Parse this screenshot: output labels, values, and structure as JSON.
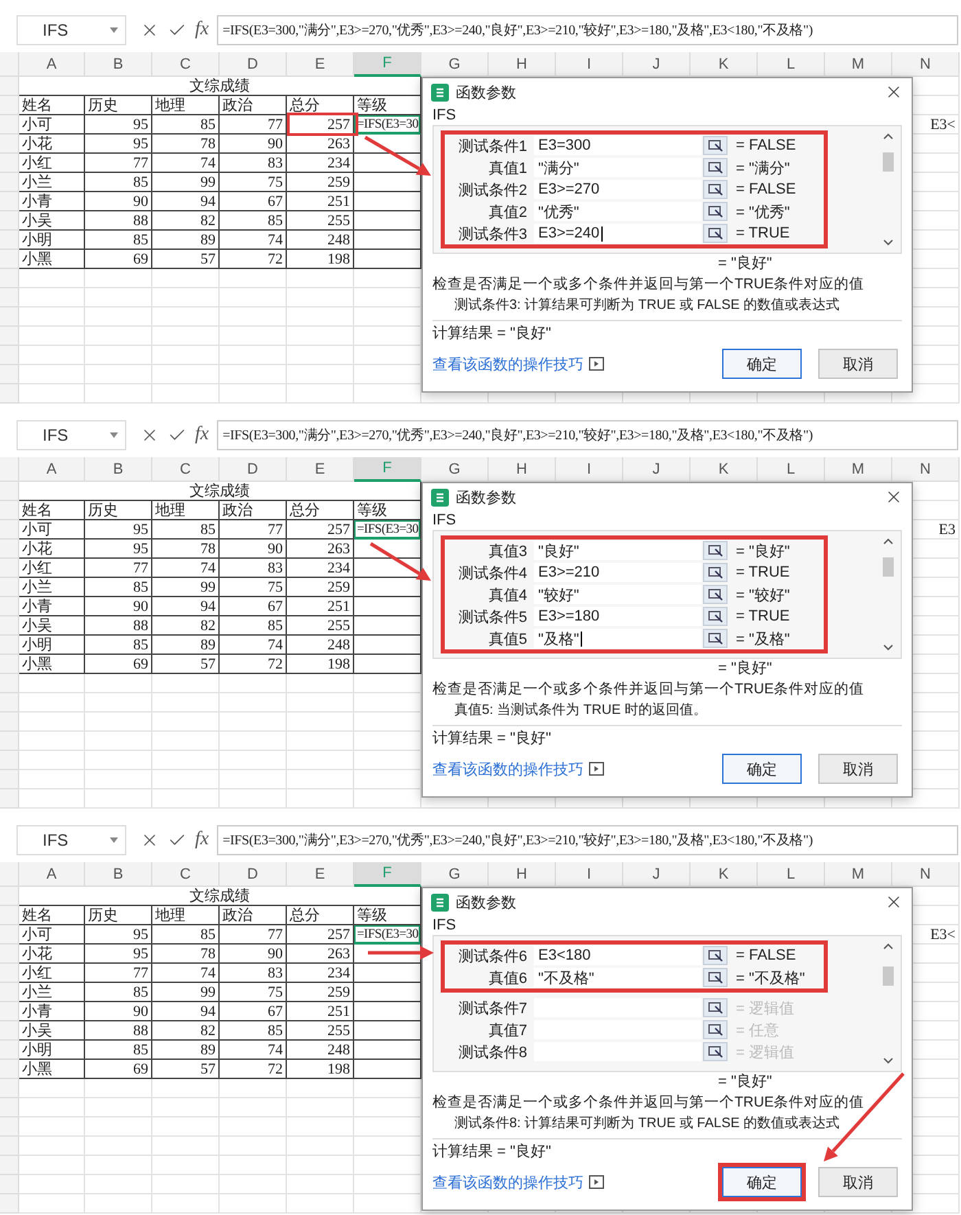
{
  "panels": [
    {
      "name_box": "IFS",
      "fx_label": "fx",
      "formula": "=IFS(E3=300,\"满分\",E3>=270,\"优秀\",E3>=240,\"良好\",E3>=210,\"较好\",E3>=180,\"及格\",E3<180,\"不及格\")",
      "columns": [
        {
          "label": "A",
          "selected": false
        },
        {
          "label": "B",
          "selected": false
        },
        {
          "label": "C",
          "selected": false
        },
        {
          "label": "D",
          "selected": false
        },
        {
          "label": "E",
          "selected": false
        },
        {
          "label": "F",
          "selected": true
        },
        {
          "label": "G",
          "selected": false
        },
        {
          "label": "H",
          "selected": false
        },
        {
          "label": "I",
          "selected": false
        },
        {
          "label": "J",
          "selected": false
        },
        {
          "label": "K",
          "selected": false
        },
        {
          "label": "L",
          "selected": false
        },
        {
          "label": "M",
          "selected": false
        },
        {
          "label": "N",
          "selected": false
        }
      ],
      "sheet_title": "文综成绩",
      "headers": [
        "姓名",
        "历史",
        "地理",
        "政治",
        "总分",
        "等级"
      ],
      "rows": [
        {
          "cells": [
            "小可",
            "95",
            "85",
            "77",
            "257"
          ],
          "grade": "=IFS(E3=30",
          "active": true,
          "total_marked": true,
          "tail": "E3<"
        },
        {
          "cells": [
            "小花",
            "95",
            "78",
            "90",
            "263"
          ],
          "active": false,
          "total_marked": false
        },
        {
          "cells": [
            "小红",
            "77",
            "74",
            "83",
            "234"
          ],
          "active": false,
          "total_marked": false
        },
        {
          "cells": [
            "小兰",
            "85",
            "99",
            "75",
            "259"
          ],
          "active": false,
          "total_marked": false
        },
        {
          "cells": [
            "小青",
            "90",
            "94",
            "67",
            "251"
          ],
          "active": false,
          "total_marked": false
        },
        {
          "cells": [
            "小吴",
            "88",
            "82",
            "85",
            "255"
          ],
          "active": false,
          "total_marked": false
        },
        {
          "cells": [
            "小明",
            "85",
            "89",
            "74",
            "248"
          ],
          "active": false,
          "total_marked": false
        },
        {
          "cells": [
            "小黑",
            "69",
            "57",
            "72",
            "198"
          ],
          "active": false,
          "total_marked": false
        }
      ],
      "dialog": {
        "title": "函数参数",
        "function": "IFS",
        "args": [
          {
            "label": "测试条件1",
            "value": "E3=300",
            "result": "= FALSE",
            "highlighted": true,
            "dimmed": false,
            "caret": false
          },
          {
            "label": "真值1",
            "value": "\"满分\"",
            "result": "= \"满分\"",
            "highlighted": true,
            "dimmed": false,
            "caret": false
          },
          {
            "label": "测试条件2",
            "value": "E3>=270",
            "result": "= FALSE",
            "highlighted": true,
            "dimmed": false,
            "caret": false
          },
          {
            "label": "真值2",
            "value": "\"优秀\"",
            "result": "= \"优秀\"",
            "highlighted": true,
            "dimmed": false,
            "caret": false
          },
          {
            "label": "测试条件3",
            "value": "E3>=240",
            "result": "= TRUE",
            "highlighted": true,
            "dimmed": false,
            "caret": true
          }
        ],
        "value_result": "= \"良好\"",
        "description": "检查是否满足一个或多个条件并返回与第一个TRUE条件对应的值",
        "arg_help": "测试条件3:  计算结果可判断为 TRUE 或 FALSE 的数值或表达式",
        "calc_result": "计算结果 = \"良好\"",
        "link": "查看该函数的操作技巧",
        "buttons": [
          {
            "label": "确定",
            "default": true,
            "highlighted": false
          },
          {
            "label": "取消",
            "default": false,
            "highlighted": false
          }
        ]
      },
      "arrows": [
        {
          "kind": "from-total"
        }
      ]
    },
    {
      "name_box": "IFS",
      "fx_label": "fx",
      "formula": "=IFS(E3=300,\"满分\",E3>=270,\"优秀\",E3>=240,\"良好\",E3>=210,\"较好\",E3>=180,\"及格\",E3<180,\"不及格\")",
      "columns": [
        {
          "label": "A",
          "selected": false
        },
        {
          "label": "B",
          "selected": false
        },
        {
          "label": "C",
          "selected": false
        },
        {
          "label": "D",
          "selected": false
        },
        {
          "label": "E",
          "selected": false
        },
        {
          "label": "F",
          "selected": true
        },
        {
          "label": "G",
          "selected": false
        },
        {
          "label": "H",
          "selected": false
        },
        {
          "label": "I",
          "selected": false
        },
        {
          "label": "J",
          "selected": false
        },
        {
          "label": "K",
          "selected": false
        },
        {
          "label": "L",
          "selected": false
        },
        {
          "label": "M",
          "selected": false
        },
        {
          "label": "N",
          "selected": false
        }
      ],
      "sheet_title": "文综成绩",
      "headers": [
        "姓名",
        "历史",
        "地理",
        "政治",
        "总分",
        "等级"
      ],
      "rows": [
        {
          "cells": [
            "小可",
            "95",
            "85",
            "77",
            "257"
          ],
          "grade": "=IFS(E3=30",
          "active": true,
          "total_marked": false,
          "tail": "E3"
        },
        {
          "cells": [
            "小花",
            "95",
            "78",
            "90",
            "263"
          ],
          "active": false,
          "total_marked": false
        },
        {
          "cells": [
            "小红",
            "77",
            "74",
            "83",
            "234"
          ],
          "active": false,
          "total_marked": false
        },
        {
          "cells": [
            "小兰",
            "85",
            "99",
            "75",
            "259"
          ],
          "active": false,
          "total_marked": false
        },
        {
          "cells": [
            "小青",
            "90",
            "94",
            "67",
            "251"
          ],
          "active": false,
          "total_marked": false
        },
        {
          "cells": [
            "小吴",
            "88",
            "82",
            "85",
            "255"
          ],
          "active": false,
          "total_marked": false
        },
        {
          "cells": [
            "小明",
            "85",
            "89",
            "74",
            "248"
          ],
          "active": false,
          "total_marked": false
        },
        {
          "cells": [
            "小黑",
            "69",
            "57",
            "72",
            "198"
          ],
          "active": false,
          "total_marked": false
        }
      ],
      "dialog": {
        "title": "函数参数",
        "function": "IFS",
        "args": [
          {
            "label": "真值3",
            "value": "\"良好\"",
            "result": "= \"良好\"",
            "highlighted": true,
            "dimmed": false,
            "caret": false
          },
          {
            "label": "测试条件4",
            "value": "E3>=210",
            "result": "= TRUE",
            "highlighted": true,
            "dimmed": false,
            "caret": false
          },
          {
            "label": "真值4",
            "value": "\"较好\"",
            "result": "= \"较好\"",
            "highlighted": true,
            "dimmed": false,
            "caret": false
          },
          {
            "label": "测试条件5",
            "value": "E3>=180",
            "result": "= TRUE",
            "highlighted": true,
            "dimmed": false,
            "caret": false
          },
          {
            "label": "真值5",
            "value": "\"及格\"",
            "result": "= \"及格\"",
            "highlighted": true,
            "dimmed": false,
            "caret": true
          }
        ],
        "value_result": "= \"良好\"",
        "description": "检查是否满足一个或多个条件并返回与第一个TRUE条件对应的值",
        "arg_help": "真值5:  当测试条件为 TRUE 时的返回值。",
        "calc_result": "计算结果 = \"良好\"",
        "link": "查看该函数的操作技巧",
        "buttons": [
          {
            "label": "确定",
            "default": true,
            "highlighted": false
          },
          {
            "label": "取消",
            "default": false,
            "highlighted": false
          }
        ]
      },
      "arrows": [
        {
          "kind": "from-grade"
        }
      ]
    },
    {
      "name_box": "IFS",
      "fx_label": "fx",
      "formula": "=IFS(E3=300,\"满分\",E3>=270,\"优秀\",E3>=240,\"良好\",E3>=210,\"较好\",E3>=180,\"及格\",E3<180,\"不及格\")",
      "columns": [
        {
          "label": "A",
          "selected": false
        },
        {
          "label": "B",
          "selected": false
        },
        {
          "label": "C",
          "selected": false
        },
        {
          "label": "D",
          "selected": false
        },
        {
          "label": "E",
          "selected": false
        },
        {
          "label": "F",
          "selected": true
        },
        {
          "label": "G",
          "selected": false
        },
        {
          "label": "H",
          "selected": false
        },
        {
          "label": "I",
          "selected": false
        },
        {
          "label": "J",
          "selected": false
        },
        {
          "label": "K",
          "selected": false
        },
        {
          "label": "L",
          "selected": false
        },
        {
          "label": "M",
          "selected": false
        },
        {
          "label": "N",
          "selected": false
        }
      ],
      "sheet_title": "文综成绩",
      "headers": [
        "姓名",
        "历史",
        "地理",
        "政治",
        "总分",
        "等级"
      ],
      "rows": [
        {
          "cells": [
            "小可",
            "95",
            "85",
            "77",
            "257"
          ],
          "grade": "=IFS(E3=30",
          "active": true,
          "total_marked": false,
          "tail": "E3<"
        },
        {
          "cells": [
            "小花",
            "95",
            "78",
            "90",
            "263"
          ],
          "active": false,
          "total_marked": false
        },
        {
          "cells": [
            "小红",
            "77",
            "74",
            "83",
            "234"
          ],
          "active": false,
          "total_marked": false
        },
        {
          "cells": [
            "小兰",
            "85",
            "99",
            "75",
            "259"
          ],
          "active": false,
          "total_marked": false
        },
        {
          "cells": [
            "小青",
            "90",
            "94",
            "67",
            "251"
          ],
          "active": false,
          "total_marked": false
        },
        {
          "cells": [
            "小吴",
            "88",
            "82",
            "85",
            "255"
          ],
          "active": false,
          "total_marked": false
        },
        {
          "cells": [
            "小明",
            "85",
            "89",
            "74",
            "248"
          ],
          "active": false,
          "total_marked": false
        },
        {
          "cells": [
            "小黑",
            "69",
            "57",
            "72",
            "198"
          ],
          "active": false,
          "total_marked": false
        }
      ],
      "dialog": {
        "title": "函数参数",
        "function": "IFS",
        "args": [
          {
            "label": "测试条件6",
            "value": "E3<180",
            "result": "= FALSE",
            "highlighted": true,
            "dimmed": false,
            "caret": false
          },
          {
            "label": "真值6",
            "value": "\"不及格\"",
            "result": "= \"不及格\"",
            "highlighted": true,
            "dimmed": false,
            "caret": false
          },
          {
            "label": "测试条件7",
            "result": "= 逻辑值",
            "highlighted": false,
            "dimmed": true,
            "caret": false
          },
          {
            "label": "真值7",
            "result": "= 任意",
            "highlighted": false,
            "dimmed": true,
            "caret": false
          },
          {
            "label": "测试条件8",
            "result": "= 逻辑值",
            "highlighted": false,
            "dimmed": true,
            "caret": false
          }
        ],
        "value_result": "= \"良好\"",
        "description": "检查是否满足一个或多个条件并返回与第一个TRUE条件对应的值",
        "arg_help": "测试条件8:  计算结果可判断为 TRUE 或 FALSE 的数值或表达式",
        "calc_result": "计算结果 = \"良好\"",
        "link": "查看该函数的操作技巧",
        "buttons": [
          {
            "label": "确定",
            "default": true,
            "highlighted": true
          },
          {
            "label": "取消",
            "default": false,
            "highlighted": false
          }
        ]
      },
      "arrows": [
        {
          "kind": "to-dialog-row"
        },
        {
          "kind": "to-ok"
        }
      ]
    }
  ]
}
